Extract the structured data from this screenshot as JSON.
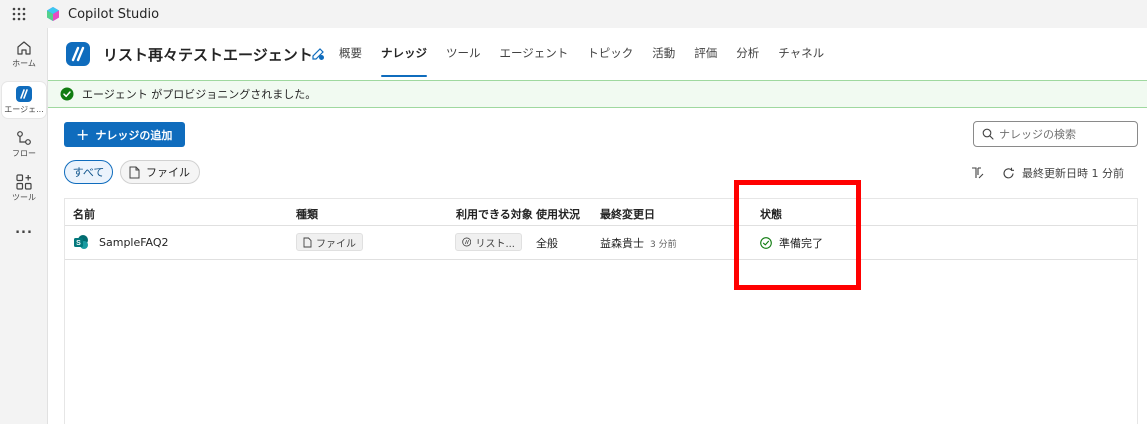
{
  "app": {
    "title": "Copilot Studio"
  },
  "rail": {
    "items": [
      {
        "label": "ホーム",
        "icon": "home-icon"
      },
      {
        "label": "エージェ...",
        "icon": "agent-icon"
      },
      {
        "label": "フロー",
        "icon": "flow-icon"
      },
      {
        "label": "ツール",
        "icon": "tools-icon"
      },
      {
        "label": "...",
        "icon": "more-icon"
      }
    ]
  },
  "header": {
    "agent_name": "リスト再々テストエージェント",
    "tabs": [
      {
        "label": "概要"
      },
      {
        "label": "ナレッジ",
        "active": true
      },
      {
        "label": "ツール"
      },
      {
        "label": "エージェント"
      },
      {
        "label": "トピック"
      },
      {
        "label": "活動"
      },
      {
        "label": "評価"
      },
      {
        "label": "分析"
      },
      {
        "label": "チャネル"
      }
    ]
  },
  "banner": {
    "text": "エージェント がプロビジョニングされました。",
    "color": "#107c10"
  },
  "toolbar": {
    "add_label": "ナレッジの追加",
    "search_placeholder": "ナレッジの検索",
    "filter_all": "すべて",
    "filter_file": "ファイル",
    "last_updated": "最終更新日時 1 分前"
  },
  "table": {
    "headers": {
      "name": "名前",
      "type": "種類",
      "target": "利用できる対象",
      "usage": "使用状況",
      "modified": "最終変更日",
      "status": "状態"
    },
    "rows": [
      {
        "name": "SampleFAQ2",
        "type": "ファイル",
        "target": "リスト...",
        "usage": "全般",
        "modified_by": "益森貴士",
        "modified_time": "3 分前",
        "status": "準備完了"
      }
    ]
  },
  "colors": {
    "accent": "#0f6cbd",
    "success": "#107c10",
    "highlight": "#ff0000"
  }
}
